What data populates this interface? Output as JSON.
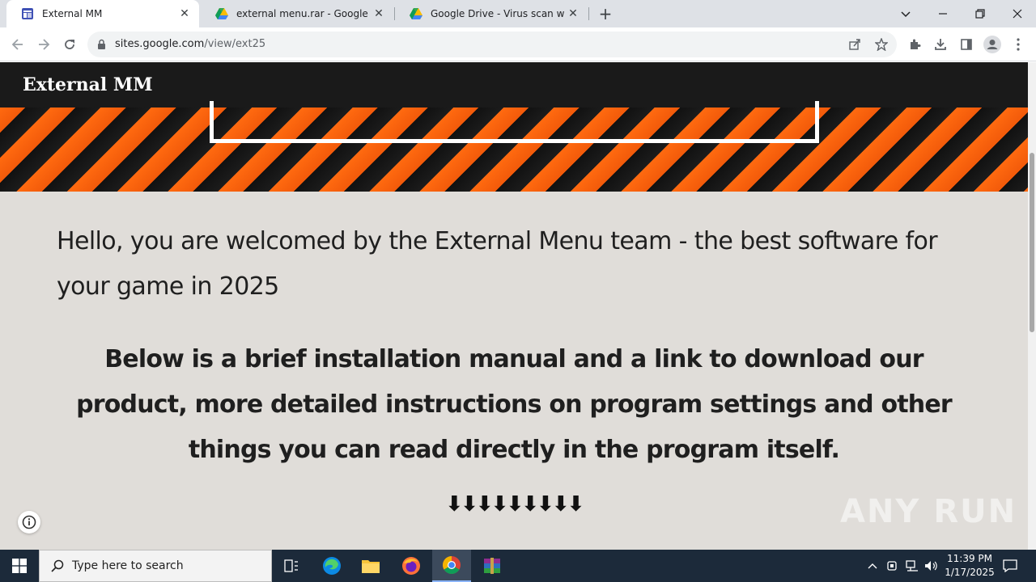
{
  "browser": {
    "tabs": [
      {
        "title": "External MM",
        "active": true,
        "icon": "google-sites-icon"
      },
      {
        "title": "external menu.rar - Google Drive",
        "active": false,
        "icon": "google-drive-icon"
      },
      {
        "title": "Google Drive - Virus scan warnin",
        "active": false,
        "icon": "google-drive-icon"
      }
    ],
    "address": {
      "host": "sites.google.com",
      "path": "/view/ext25"
    }
  },
  "page": {
    "site_title": "External MM",
    "paragraph1": "Hello, you are welcomed by the External Menu team - the best software for your game in 2025",
    "paragraph2": "Below is a brief installation manual and a link to download our product, more detailed instructions on program settings and other things you can read directly in the program itself.",
    "arrows": "⬇⬇⬇⬇⬇⬇⬇⬇⬇"
  },
  "watermark": "ANY RUN",
  "taskbar": {
    "search_placeholder": "Type here to search",
    "time": "11:39 PM",
    "date": "1/17/2025"
  },
  "colors": {
    "banner_orange": "#ff6a10",
    "page_bg": "#e0ddd9",
    "header_bg": "#1a1a1a",
    "taskbar_bg": "#1c2a3a"
  }
}
